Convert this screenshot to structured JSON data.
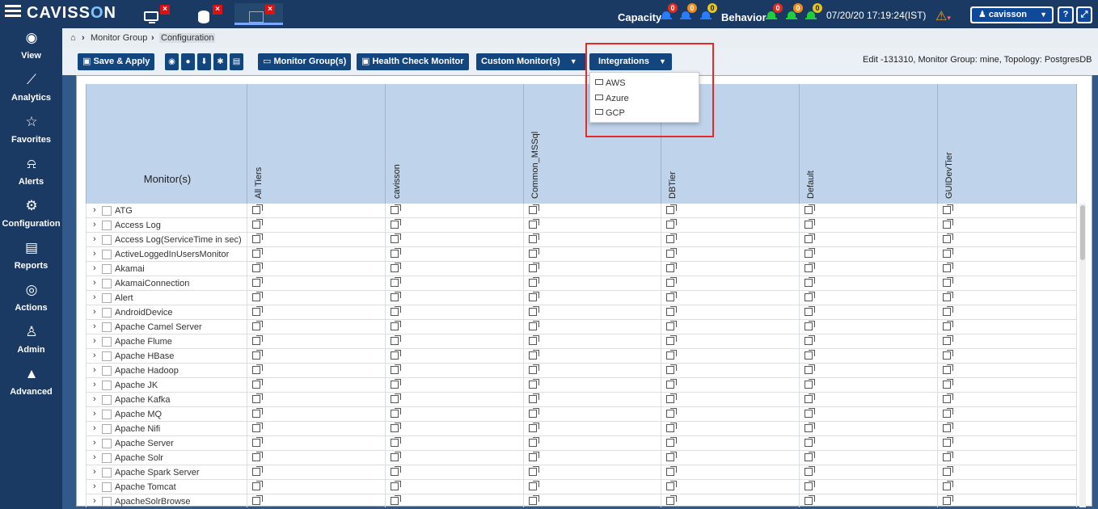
{
  "app": {
    "brand_left": "CAVISS",
    "brand_o": "O",
    "brand_right": "N"
  },
  "header": {
    "tabs": [
      {
        "icon": "monitor-icon",
        "close": "×"
      },
      {
        "icon": "database-icon",
        "close": "×"
      },
      {
        "icon": "topology-icon",
        "close": "×"
      }
    ],
    "capacity_label": "Capacity",
    "capacity_counts": [
      "0",
      "0",
      "0"
    ],
    "behavior_label": "Behavior",
    "behavior_counts": [
      "0",
      "0",
      "0"
    ],
    "datetime": "07/20/20 17:19:24(IST)",
    "user": "cavisson",
    "help": "?",
    "expand": "⤢"
  },
  "sidebar": {
    "items": [
      {
        "label": "View",
        "icon": "eye-icon",
        "glyph": "◉"
      },
      {
        "label": "Analytics",
        "icon": "chart-icon",
        "glyph": "⟋"
      },
      {
        "label": "Favorites",
        "icon": "star-icon",
        "glyph": "☆"
      },
      {
        "label": "Alerts",
        "icon": "bell-icon",
        "glyph": "⍾"
      },
      {
        "label": "Configuration",
        "icon": "gears-icon",
        "glyph": "⚙"
      },
      {
        "label": "Reports",
        "icon": "report-icon",
        "glyph": "▤"
      },
      {
        "label": "Actions",
        "icon": "actions-icon",
        "glyph": "◎"
      },
      {
        "label": "Admin",
        "icon": "admin-icon",
        "glyph": "♙"
      },
      {
        "label": "Advanced",
        "icon": "advanced-icon",
        "glyph": "▲"
      }
    ]
  },
  "breadcrumb": {
    "home": "⌂",
    "sep": "›",
    "parent": "Monitor Group",
    "current": "Configuration"
  },
  "toolbar": {
    "save_label": "Save & Apply",
    "monitor_groups_label": "Monitor Group(s)",
    "health_check_label": "Health Check Monitor",
    "custom_monitors_label": "Custom Monitor(s)",
    "integrations_label": "Integrations",
    "edit_info": "Edit -131310, Monitor Group: mine,  Topology: PostgresDB"
  },
  "integrations_menu": {
    "items": [
      "AWS",
      "Azure",
      "GCP"
    ]
  },
  "grid": {
    "first_header": "Monitor(s)",
    "tier_headers": [
      "All Tiers",
      "cavisson",
      "Common_MSSql",
      "DBTier",
      "Default",
      "GUIDevTier"
    ],
    "monitors": [
      "ATG",
      "Access Log",
      "Access Log(ServiceTime in sec)",
      "ActiveLoggedInUsersMonitor",
      "Akamai",
      "AkamaiConnection",
      "Alert",
      "AndroidDevice",
      "Apache Camel Server",
      "Apache Flume",
      "Apache HBase",
      "Apache Hadoop",
      "Apache JK",
      "Apache Kafka",
      "Apache MQ",
      "Apache Nifi",
      "Apache Server",
      "Apache Solr",
      "Apache Spark Server",
      "Apache Tomcat",
      "ApacheSolrBrowse"
    ]
  }
}
